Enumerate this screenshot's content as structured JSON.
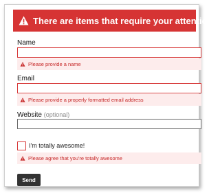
{
  "banner": {
    "message": "There are items that require your attention",
    "icon": "warning-triangle-icon",
    "color": "#d63434"
  },
  "form": {
    "name": {
      "label": "Name",
      "value": "",
      "error": "Please provide a name"
    },
    "email": {
      "label": "Email",
      "value": "",
      "error": "Please provide a properly formatted email address"
    },
    "website": {
      "label": "Website",
      "optional": "(optional)",
      "value": ""
    },
    "awesome": {
      "label": "I'm totally awesome!",
      "checked": false,
      "error": "Please agree that you're totally awesome"
    },
    "submit_label": "Send"
  },
  "colors": {
    "error_text": "#c62828",
    "error_background": "#fdecec",
    "button": "#333333"
  }
}
